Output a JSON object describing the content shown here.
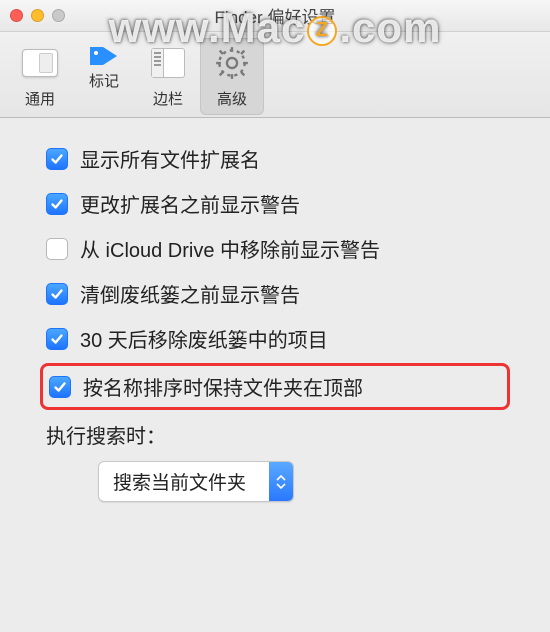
{
  "window": {
    "title": "Finder 偏好设置"
  },
  "watermark": {
    "text_before": "www.Mac",
    "text_after": ".com",
    "z": "Z"
  },
  "toolbar": {
    "tabs": [
      {
        "label": "通用",
        "selected": false
      },
      {
        "label": "标记",
        "selected": false
      },
      {
        "label": "边栏",
        "selected": false
      },
      {
        "label": "高级",
        "selected": true
      }
    ]
  },
  "options": [
    {
      "label": "显示所有文件扩展名",
      "checked": true,
      "highlight": false
    },
    {
      "label": "更改扩展名之前显示警告",
      "checked": true,
      "highlight": false
    },
    {
      "label": "从 iCloud Drive 中移除前显示警告",
      "checked": false,
      "highlight": false
    },
    {
      "label": "清倒废纸篓之前显示警告",
      "checked": true,
      "highlight": false
    },
    {
      "label": "30 天后移除废纸篓中的项目",
      "checked": true,
      "highlight": false
    },
    {
      "label": "按名称排序时保持文件夹在顶部",
      "checked": true,
      "highlight": true
    }
  ],
  "search": {
    "label": "执行搜索时：",
    "value": "搜索当前文件夹"
  }
}
